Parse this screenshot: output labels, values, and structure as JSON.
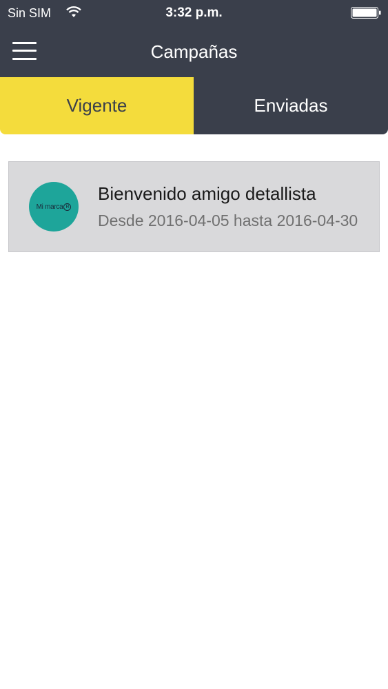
{
  "status_bar": {
    "carrier": "Sin SIM",
    "time": "3:32 p.m."
  },
  "header": {
    "title": "Campañas",
    "menu_icon": "hamburger-menu-icon"
  },
  "tabs": [
    {
      "label": "Vigente",
      "active": true
    },
    {
      "label": "Enviadas",
      "active": false
    }
  ],
  "campaigns": [
    {
      "title": "Bienvenido amigo detallista",
      "subtitle": "Desde 2016-04-05 hasta 2016-04-30",
      "logo_text": "Mi marca",
      "logo_mark": "R"
    }
  ],
  "colors": {
    "header_bg": "#3a3f4b",
    "active_tab": "#f4dc3c",
    "card_bg": "#d9d9db",
    "logo_bg": "#1ea59a"
  }
}
